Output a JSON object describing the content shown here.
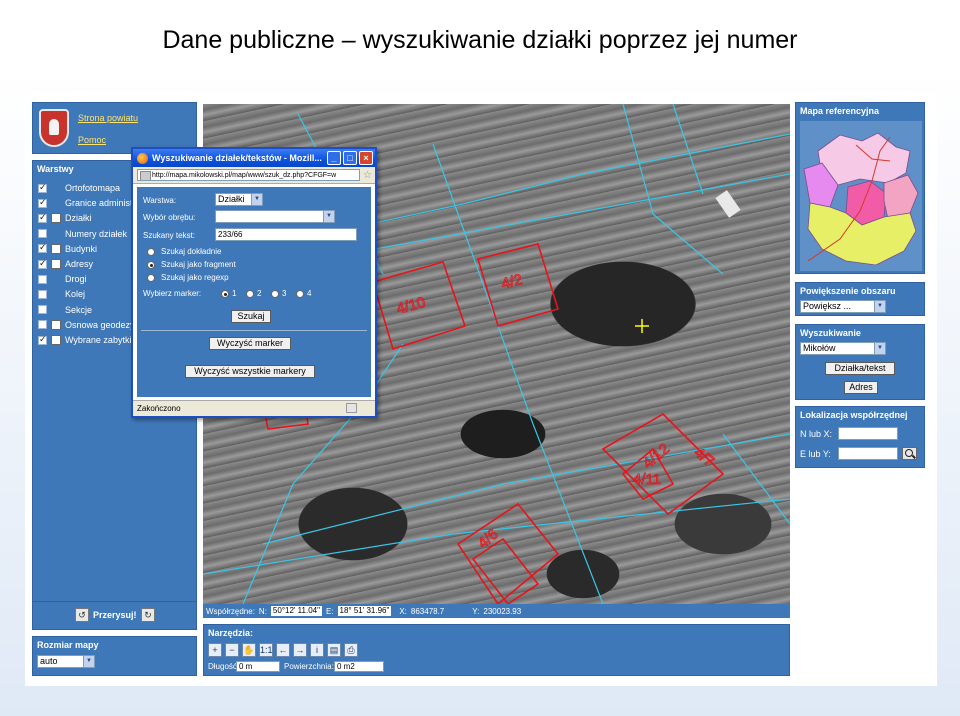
{
  "slide_title": "Dane publiczne – wyszukiwanie działki poprzez jej numer",
  "top_links": {
    "strona": "Strona powiatu",
    "pomoc": "Pomoc"
  },
  "layers": {
    "title": "Warstwy",
    "items": [
      {
        "label": "Ortofotomapa",
        "checked": true,
        "legend": ""
      },
      {
        "label": "Granice administracyjne",
        "checked": true,
        "legend": ""
      },
      {
        "label": "Działki",
        "checked": true,
        "legend": "x"
      },
      {
        "label": "Numery działek",
        "checked": false,
        "legend": ""
      },
      {
        "label": "Budynki",
        "checked": true,
        "legend": "b"
      },
      {
        "label": "Adresy",
        "checked": true,
        "legend": "a"
      },
      {
        "label": "Drogi",
        "checked": false,
        "legend": ""
      },
      {
        "label": "Kolej",
        "checked": false,
        "legend": ""
      },
      {
        "label": "Sekcje",
        "checked": false,
        "legend": ""
      },
      {
        "label": "Osnowa geodezyjna",
        "checked": false,
        "legend": "o"
      },
      {
        "label": "Wybrane zabytki",
        "checked": true,
        "legend": "z"
      }
    ]
  },
  "redraw": {
    "label": "Przerysuj!"
  },
  "map_size": {
    "title": "Rozmiar mapy",
    "value": "auto"
  },
  "map": {
    "parcel_labels": [
      "4/10",
      "4/2",
      "4/12",
      "4/7",
      "4/6",
      "4/11"
    ],
    "marker_color": "#ffff00"
  },
  "coords": {
    "label": "Współrzędne:",
    "n_label": "N:",
    "n_value": "50°12' 11.04\"",
    "e_label": "E:",
    "e_value": "18° 51' 31.96\"",
    "x_label": "X:",
    "x_value": "863478.7",
    "y_label": "Y:",
    "y_value": "230023.93"
  },
  "tools": {
    "title": "Narzędzia:",
    "buttons": [
      {
        "name": "zoom-in-icon",
        "glyph": "+"
      },
      {
        "name": "zoom-out-icon",
        "glyph": "−"
      },
      {
        "name": "pan-hand-icon",
        "glyph": "✋"
      },
      {
        "name": "scale-1-1-icon",
        "glyph": "1:1"
      },
      {
        "name": "arrow-left-icon",
        "glyph": "←"
      },
      {
        "name": "arrow-right-icon",
        "glyph": "→"
      },
      {
        "name": "info-icon",
        "glyph": "i"
      },
      {
        "name": "save-icon",
        "glyph": "▤"
      },
      {
        "name": "print-icon",
        "glyph": "⎙"
      }
    ],
    "length_label": "Długość:",
    "length_value": "0 m",
    "area_label": "Powierzchnia:",
    "area_value": "0 m2"
  },
  "reference": {
    "title": "Mapa referencyjna"
  },
  "zoom": {
    "title": "Powiększenie obszaru",
    "value": "Powiększ ..."
  },
  "search": {
    "title": "Wyszukiwanie",
    "municipality": "Mikołów",
    "parcel_button": "Działka/tekst",
    "address_button": "Adres"
  },
  "locate": {
    "title": "Lokalizacja współrzędnej",
    "x_label": "N lub X:",
    "y_label": "E lub Y:",
    "x_value": "",
    "y_value": ""
  },
  "popup": {
    "title": "Wyszukiwanie działek/tekstów - Mozill...",
    "url": "http://mapa.mikolowski.pl/map/www/szuk_dz.php?CFGF=w",
    "layer_label": "Warstwa:",
    "layer_value": "Działki",
    "precinct_label": "Wybór obrębu:",
    "precinct_value": "",
    "search_label": "Szukany tekst:",
    "search_value": "233/66",
    "radio_exact": "Szukaj dokładnie",
    "radio_fragment": "Szukaj jako fragment",
    "radio_regexp": "Szukaj jako regexp",
    "marker_label": "Wybierz marker:",
    "marker_options": [
      "1",
      "2",
      "3",
      "4"
    ],
    "search_button": "Szukaj",
    "clear_marker_button": "Wyczyść marker",
    "clear_all_button": "Wyczyść wszystkie markery",
    "status": "Zakończono"
  }
}
